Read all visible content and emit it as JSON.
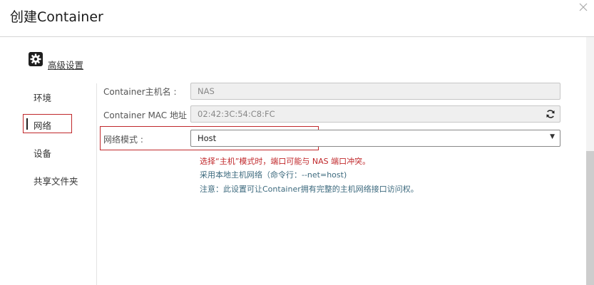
{
  "dialog": {
    "title": "创建Container",
    "close_icon": "close-icon"
  },
  "section": {
    "label": "高级设置",
    "icon": "gear-icon"
  },
  "sidebar": {
    "items": [
      {
        "label": "环境"
      },
      {
        "label": "网络",
        "active": true
      },
      {
        "label": "设备"
      },
      {
        "label": "共享文件夹"
      }
    ]
  },
  "form": {
    "hostname": {
      "label": "Container主机名 :",
      "value": "NAS"
    },
    "mac": {
      "label": "Container MAC 地址 :",
      "value": "02:42:3C:54:C8:FC",
      "icon": "refresh-icon"
    },
    "network_mode": {
      "label": "网络模式 :",
      "value": "Host"
    }
  },
  "hints": {
    "warning": "选择“主机”模式时，端口可能与 NAS 端口冲突。",
    "command": "采用本地主机网络（命令行：--net=host)",
    "note": "注意：此设置可让Container拥有完整的主机网络接口访问权。"
  },
  "colors": {
    "highlight": "#c0282b",
    "warning_text": "#c0282b",
    "info_text": "#3d6a7e"
  }
}
